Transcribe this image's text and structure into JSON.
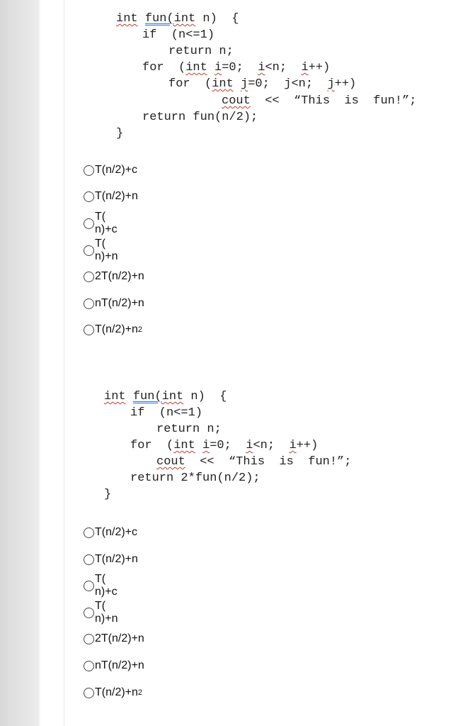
{
  "question1": {
    "code": {
      "line1_a": "int",
      "line1_b": "fun",
      "line1_c": "(",
      "line1_d": "int",
      "line1_e": " n)  {",
      "line2": "if  (n<=1)",
      "line3": "return n;",
      "line4_a": "for  (",
      "line4_b": "int",
      "line4_c": " ",
      "line4_d": "i",
      "line4_e": "=0;  ",
      "line4_f": "i",
      "line4_g": "<n;  ",
      "line4_h": "i",
      "line4_i": "++)",
      "line5_a": "for  (",
      "line5_b": "int",
      "line5_c": " ",
      "line5_d": "j",
      "line5_e": "=0;  j<n;  ",
      "line5_f": "j",
      "line5_g": "++)",
      "line6_a": "cout",
      "line6_b": "  <<  “This  is  fun!”;",
      "line7": "return fun(n/2);",
      "line8": "}"
    },
    "options": [
      {
        "text": "T(n/2)+c"
      },
      {
        "text": "T(n/2)+n"
      },
      {
        "text": "T( n)+c"
      },
      {
        "text": "T( n)+n"
      },
      {
        "text": "2T(n/2)+n"
      },
      {
        "text": "nT(n/2)+n"
      },
      {
        "text": "T(n/2)+n",
        "sup": "2"
      }
    ]
  },
  "question2": {
    "code": {
      "line1_a": "int",
      "line1_b": "fun",
      "line1_c": "(",
      "line1_d": "int",
      "line1_e": " n)  {",
      "line2": "if  (n<=1)",
      "line3": "return n;",
      "line4_a": "for  (",
      "line4_b": "int",
      "line4_c": " ",
      "line4_d": "i",
      "line4_e": "=0;  ",
      "line4_f": "i",
      "line4_g": "<n;  ",
      "line4_h": "i",
      "line4_i": "++)",
      "line5_a": "cout",
      "line5_b": "  <<  “This  is  fun!”;",
      "line6": "return 2*fun(n/2);",
      "line7": "}"
    },
    "options": [
      {
        "text": "T(n/2)+c"
      },
      {
        "text": "T(n/2)+n"
      },
      {
        "text": "T( n)+c"
      },
      {
        "text": "T( n)+n"
      },
      {
        "text": "2T(n/2)+n"
      },
      {
        "text": "nT(n/2)+n"
      },
      {
        "text": "T(n/2)+n",
        "sup": "2"
      }
    ]
  }
}
